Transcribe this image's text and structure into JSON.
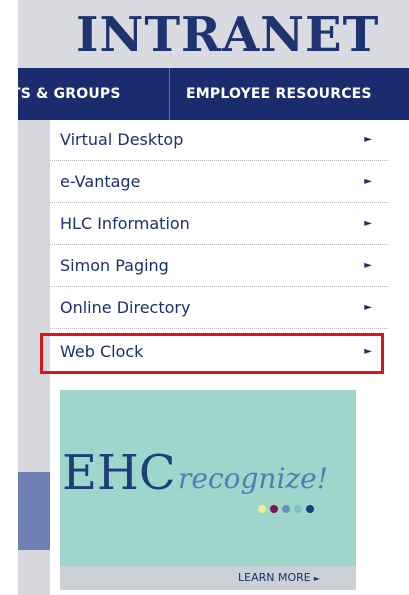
{
  "header": {
    "brand": "INTRANET"
  },
  "nav": {
    "tabs": [
      {
        "label": "TS & GROUPS"
      },
      {
        "label": "EMPLOYEE RESOURCES"
      }
    ]
  },
  "menu": {
    "items": [
      {
        "label": "Virtual Desktop",
        "arrow": "►"
      },
      {
        "label": "e-Vantage",
        "arrow": "►"
      },
      {
        "label": "HLC Information",
        "arrow": "►"
      },
      {
        "label": "Simon Paging",
        "arrow": "►"
      },
      {
        "label": "Online Directory",
        "arrow": "►"
      },
      {
        "label": "Web Clock",
        "arrow": "►",
        "highlighted": true
      }
    ]
  },
  "banner": {
    "ehc": "EHC",
    "recognize": "recognize!",
    "learn_more": "LEARN MORE",
    "learn_more_arrow": "►",
    "dot_colors": [
      "#f2ee8c",
      "#7a1a54",
      "#6b8fc2",
      "#7fc3c0",
      "#1f3d79"
    ]
  },
  "colors": {
    "navy": "#1b2c6e",
    "highlight": "#d9141a",
    "banner_bg": "#9fd6cc"
  }
}
